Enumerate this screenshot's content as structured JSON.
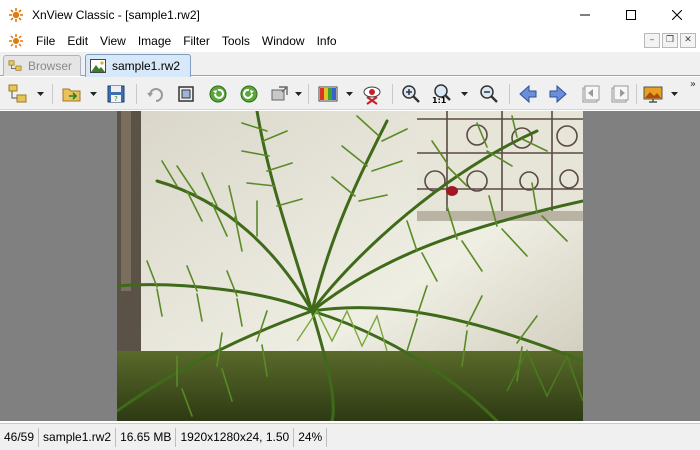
{
  "window": {
    "title": "XnView Classic - [sample1.rw2]"
  },
  "menubar": {
    "items": [
      "File",
      "Edit",
      "View",
      "Image",
      "Filter",
      "Tools",
      "Window",
      "Info"
    ]
  },
  "tabs": [
    {
      "label": "Browser",
      "active": false
    },
    {
      "label": "sample1.rw2",
      "active": true
    }
  ],
  "toolbar": {
    "buttons": [
      "folder-tree-icon",
      "open-folder-icon",
      "save-icon",
      "undo-icon",
      "crop-icon",
      "rotate-left-icon",
      "rotate-right-icon",
      "resize-icon",
      "adjust-colors-icon",
      "red-eye-icon",
      "zoom-in-icon",
      "zoom-1to1-icon",
      "zoom-out-icon",
      "previous-image-icon",
      "next-image-icon",
      "first-page-icon",
      "last-page-icon",
      "slideshow-icon"
    ],
    "zoom_label": "1:1",
    "overflow_glyph": "»"
  },
  "statusbar": {
    "position": "46/59",
    "filename": "sample1.rw2",
    "filesize": "16.65 MB",
    "dimensions": "1920x1280x24, 1.50",
    "zoom": "24%"
  },
  "colors": {
    "viewer_background": "#808080",
    "active_tab": "#d7e8f8",
    "chrome": "#f0f0f0"
  }
}
